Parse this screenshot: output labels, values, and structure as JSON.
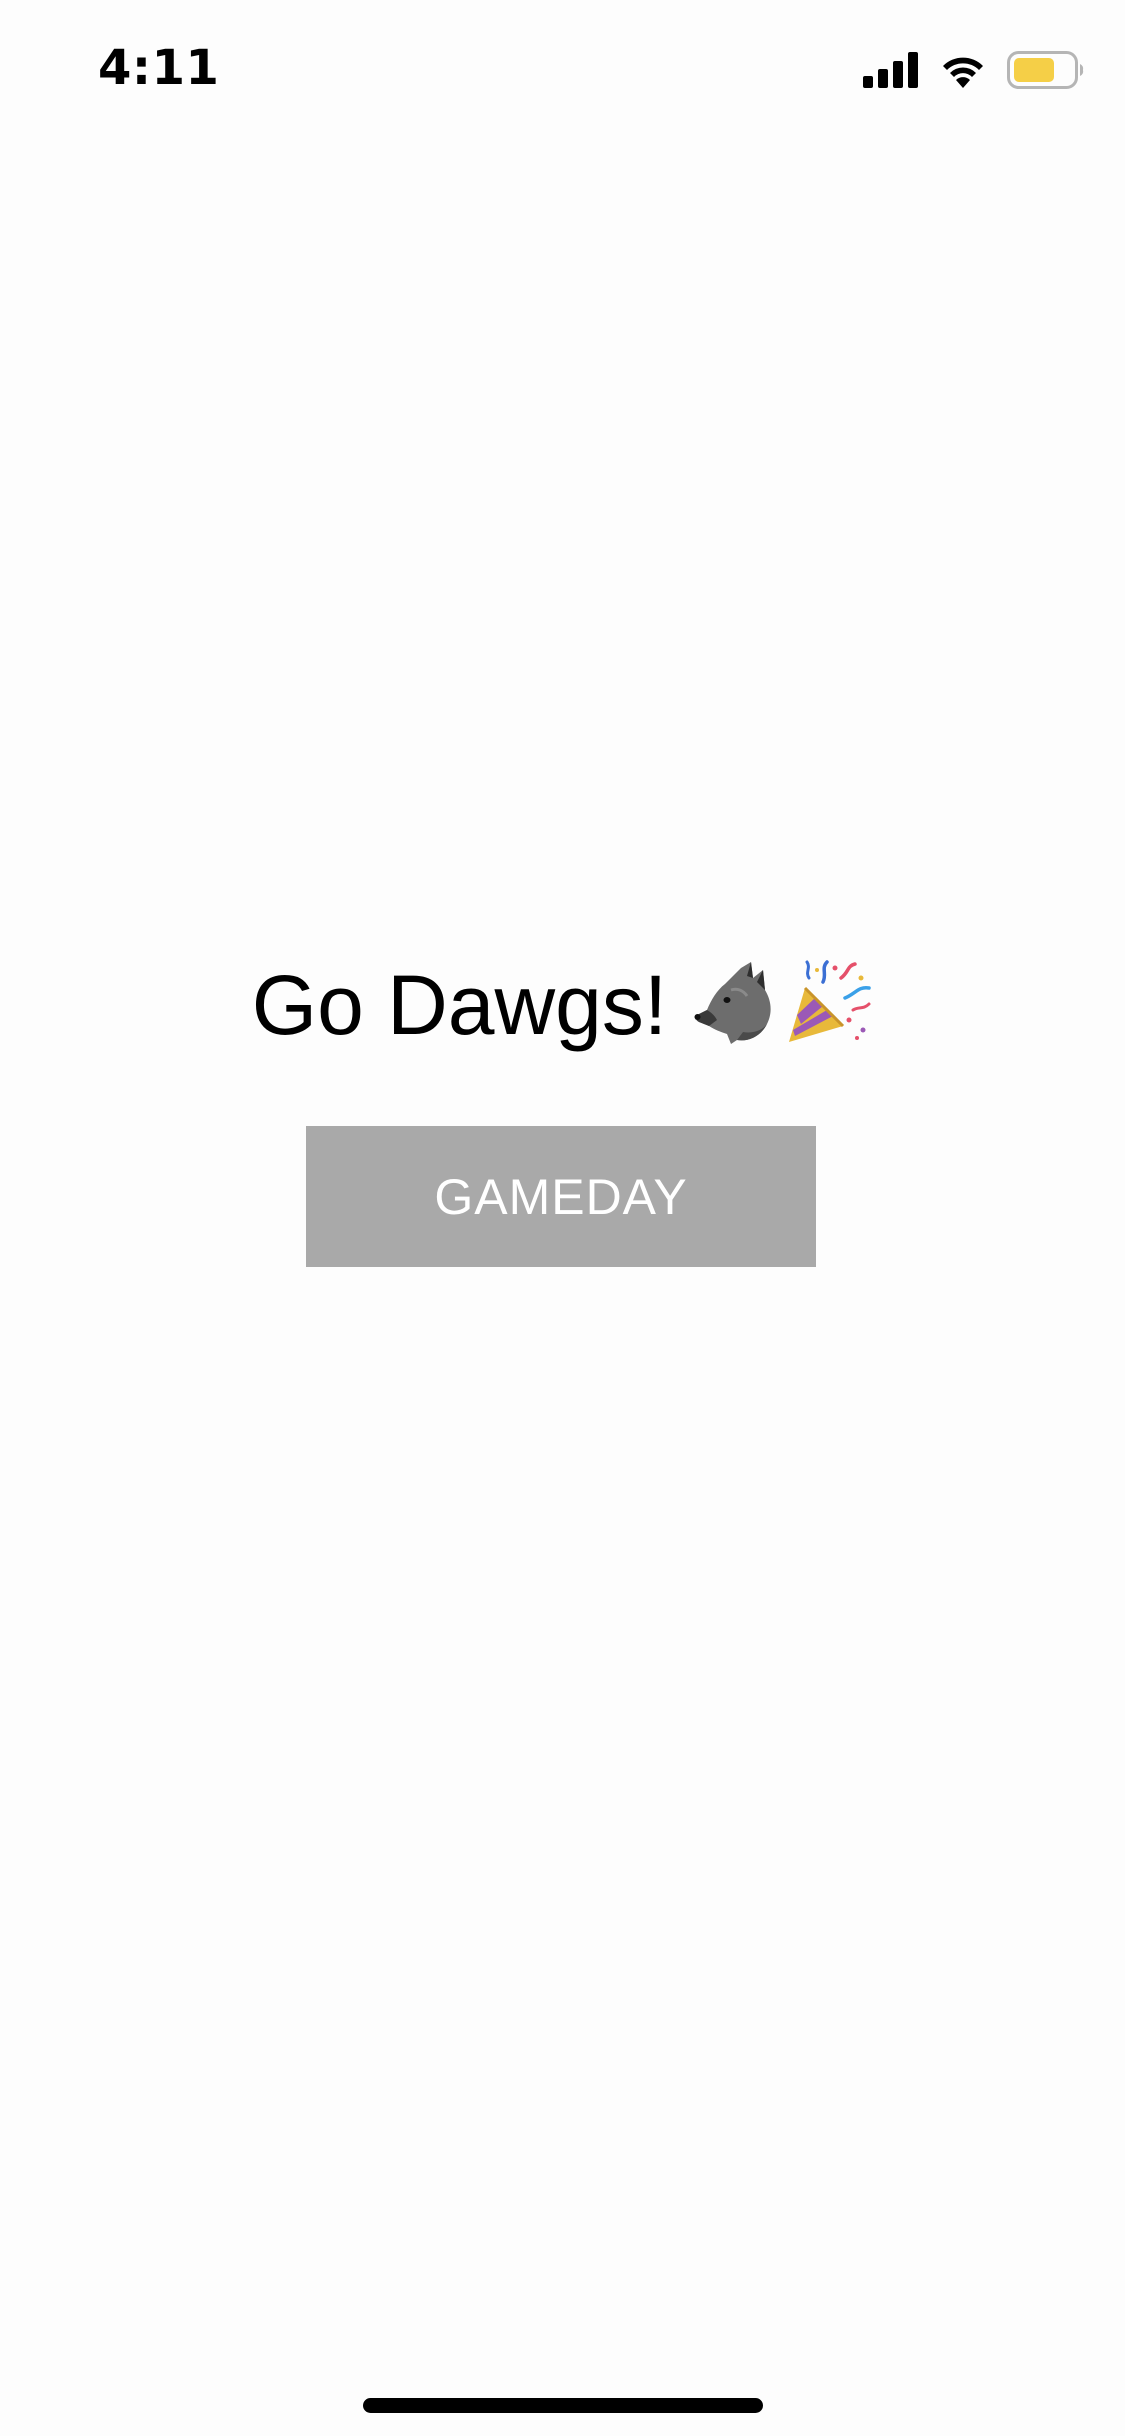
{
  "status_bar": {
    "time": "4:11",
    "icons": [
      "cellular-signal-icon",
      "wifi-icon",
      "battery-icon"
    ],
    "battery_color": "#f5cf47"
  },
  "main": {
    "headline": "Go Dawgs!",
    "headline_emojis": [
      "wolf-icon",
      "party-popper-icon"
    ],
    "button_label": "GAMEDAY",
    "button_color": "#a9a9a9",
    "button_text_color": "#ffffff"
  }
}
